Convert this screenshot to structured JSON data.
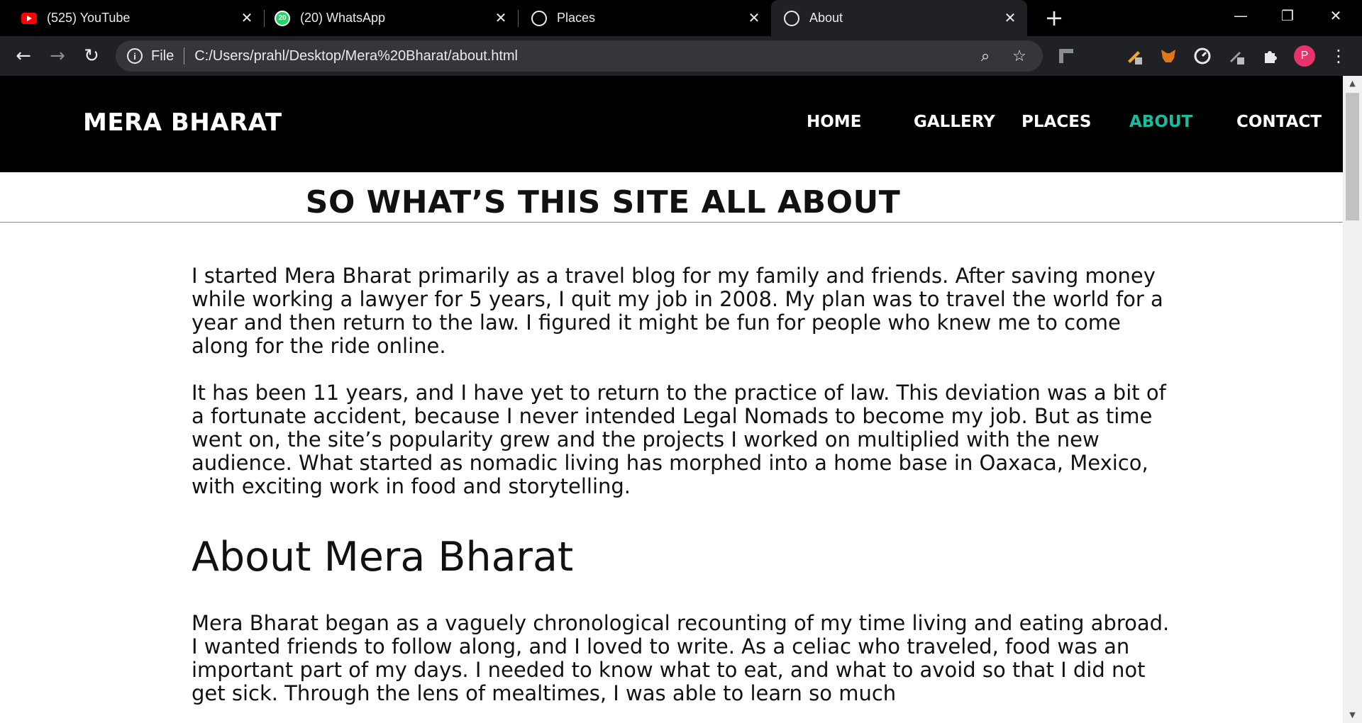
{
  "browser": {
    "tabs": [
      {
        "title": "(525) YouTube",
        "icon": "youtube-icon"
      },
      {
        "title": "(20) WhatsApp",
        "icon": "whatsapp-icon",
        "badge": "20"
      },
      {
        "title": "Places",
        "icon": "globe-icon"
      },
      {
        "title": "About",
        "icon": "globe-icon",
        "active": true
      }
    ],
    "close_glyph": "✕",
    "new_tab_glyph": "+",
    "window_controls": {
      "minimize": "—",
      "restore": "❐",
      "close": "✕"
    },
    "nav": {
      "back": "←",
      "forward": "→",
      "reload": "↻"
    },
    "omnibox": {
      "info_glyph": "i",
      "scheme_label": "File",
      "url": "C:/Users/prahl/Desktop/Mera%20Bharat/about.html",
      "zoom_glyph": "⌕",
      "bookmark_glyph": "☆"
    },
    "profile_initial": "P"
  },
  "site": {
    "brand": "MERA BHARAT",
    "nav": [
      "HOME",
      "GALLERY",
      "PLACES",
      "ABOUT",
      "CONTACT"
    ],
    "active_nav": "ABOUT",
    "accent_color": "#1abc9c",
    "hero_title": "SO WHAT’S THIS SITE ALL ABOUT",
    "paragraphs": [
      "I started Mera Bharat primarily as a travel blog for my family and friends. After saving money while working a lawyer for 5 years, I quit my job in 2008. My plan was to travel the world for a year and then return to the law. I figured it might be fun for people who knew me to come along for the ride online.",
      "It has been 11 years, and I have yet to return to the practice of law. This deviation was a bit of a fortunate accident, because I never intended Legal Nomads to become my job. But as time went on, the site’s popularity grew and the projects I worked on multiplied with the new audience. What started as nomadic living has morphed into a home base in Oaxaca, Mexico, with exciting work in food and storytelling."
    ],
    "section_heading": "About Mera Bharat",
    "section_paragraph": "Mera Bharat began as a vaguely chronological recounting of my time living and eating abroad. I wanted friends to follow along, and I loved to write. As a celiac who traveled, food was an important part of my days. I needed to know what to eat, and what to avoid so that I did not get sick. Through the lens of mealtimes, I was able to learn so much"
  }
}
